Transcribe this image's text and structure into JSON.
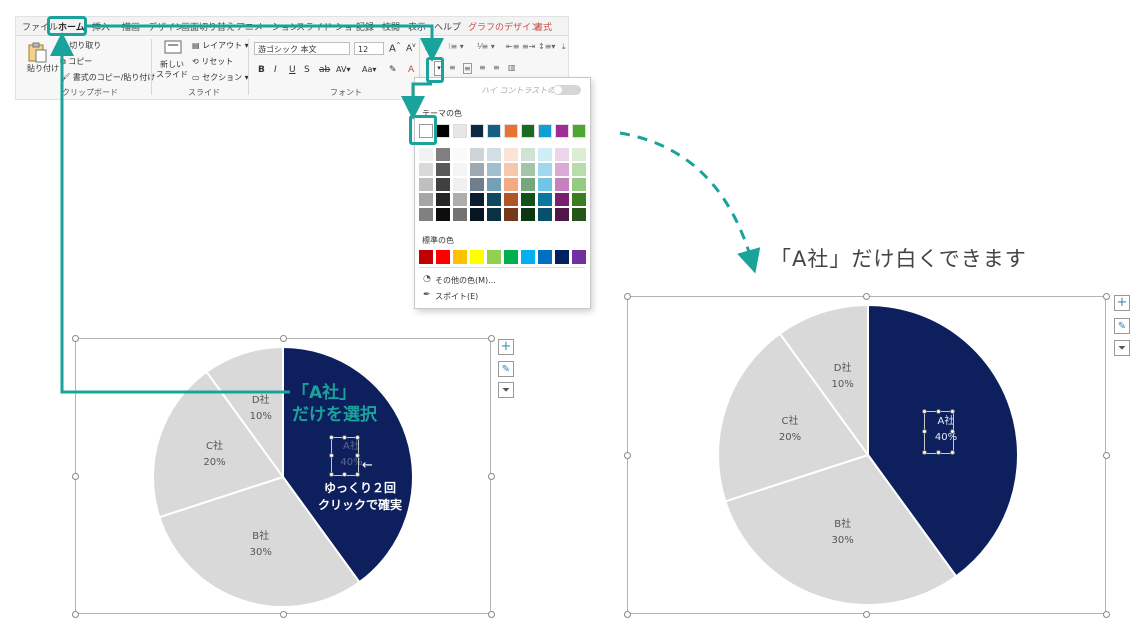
{
  "colors": {
    "accent": "#1aa39a",
    "navy": "#0d1f5c",
    "slice_gray": "#d9d9d9",
    "special_tab": "#c2504a"
  },
  "ribbon": {
    "tabs": [
      {
        "label": "ファイル"
      },
      {
        "label": "ホーム"
      },
      {
        "label": "挿入"
      },
      {
        "label": "描画"
      },
      {
        "label": "デザイン"
      },
      {
        "label": "画面切り替え"
      },
      {
        "label": "アニメーション"
      },
      {
        "label": "スライド ショー"
      },
      {
        "label": "記録"
      },
      {
        "label": "校閲"
      },
      {
        "label": "表示"
      },
      {
        "label": "ヘルプ"
      },
      {
        "label": "グラフのデザイン"
      },
      {
        "label": "書式"
      }
    ],
    "clipboard": {
      "paste_label": "貼り付け",
      "cut_label": "切り取り",
      "copy_label": "コピー",
      "format_painter_label": "書式のコピー/貼り付け",
      "group_label": "クリップボード"
    },
    "slides": {
      "new_slide_label": "新しい\nスライド",
      "layout_label": "レイアウト",
      "reset_label": "リセット",
      "section_label": "セクション",
      "group_label": "スライド"
    },
    "font": {
      "font_name": "游ゴシック 本文",
      "font_size": "12",
      "group_label": "フォント",
      "case_label": "Aa",
      "spacing_label": "AV"
    }
  },
  "dropdown": {
    "high_contrast_label": "ハイ コントラストのみ(H)",
    "theme_colors_label": "テーマの色",
    "standard_colors_label": "標準の色",
    "more_colors_label": "その他の色(M)...",
    "eyedropper_label": "スポイト(E)",
    "theme_colors": [
      "#ffffff",
      "#000000",
      "#e7e6e6",
      "#0e2841",
      "#156082",
      "#e97132",
      "#196b24",
      "#0f9ed5",
      "#a02b93",
      "#4ea72e"
    ],
    "standard_colors": [
      "#c00000",
      "#ff0000",
      "#ffc000",
      "#ffff00",
      "#92d050",
      "#00b050",
      "#00b0f0",
      "#0070c0",
      "#002060",
      "#7030a0"
    ]
  },
  "annotations": {
    "select_a_line1": "「A社」",
    "select_a_line2": "だけを選択",
    "double_click_line1": "ゆっくり２回",
    "double_click_line2": "クリックで確実",
    "arrow_glyph": "←",
    "result_caption": "「A社」だけ白くできます"
  },
  "chart_data": [
    {
      "type": "pie",
      "categories": [
        "A社",
        "B社",
        "C社",
        "D社"
      ],
      "values": [
        40,
        30,
        20,
        10
      ],
      "data_labels": [
        "40%",
        "30%",
        "20%",
        "10%"
      ]
    },
    {
      "type": "pie",
      "categories": [
        "A社",
        "B社",
        "C社",
        "D社"
      ],
      "values": [
        40,
        30,
        20,
        10
      ],
      "data_labels": [
        "40%",
        "30%",
        "20%",
        "10%"
      ]
    }
  ]
}
